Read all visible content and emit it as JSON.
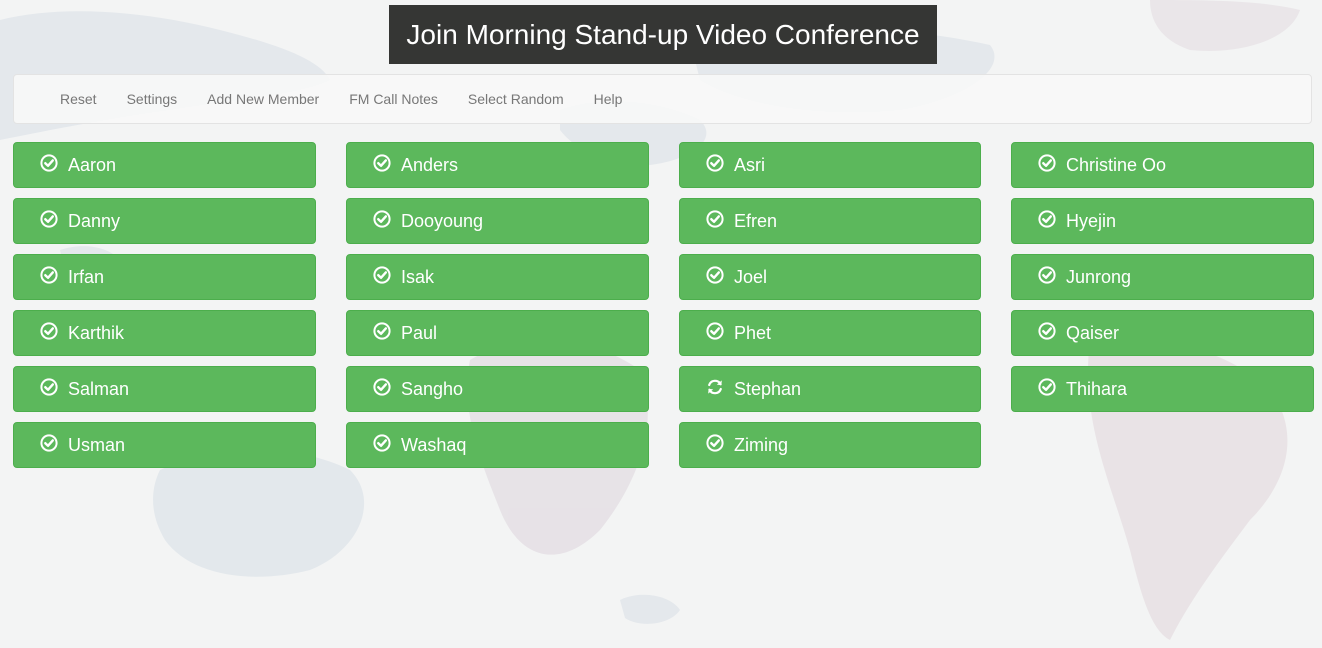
{
  "header": {
    "title": "Join Morning Stand-up Video Conference"
  },
  "nav": {
    "items": [
      {
        "label": "Reset"
      },
      {
        "label": "Settings"
      },
      {
        "label": "Add New Member"
      },
      {
        "label": "FM Call Notes"
      },
      {
        "label": "Select Random"
      },
      {
        "label": "Help"
      }
    ]
  },
  "colors": {
    "button": "#5cb85c",
    "title_bg": "#353634",
    "nav_text": "#777777"
  },
  "members": [
    {
      "name": "Aaron",
      "icon": "check-circle-icon"
    },
    {
      "name": "Anders",
      "icon": "check-circle-icon"
    },
    {
      "name": "Asri",
      "icon": "check-circle-icon"
    },
    {
      "name": "Christine Oo",
      "icon": "check-circle-icon"
    },
    {
      "name": "Danny",
      "icon": "check-circle-icon"
    },
    {
      "name": "Dooyoung",
      "icon": "check-circle-icon"
    },
    {
      "name": "Efren",
      "icon": "check-circle-icon"
    },
    {
      "name": "Hyejin",
      "icon": "check-circle-icon"
    },
    {
      "name": "Irfan",
      "icon": "check-circle-icon"
    },
    {
      "name": "Isak",
      "icon": "check-circle-icon"
    },
    {
      "name": "Joel",
      "icon": "check-circle-icon"
    },
    {
      "name": "Junrong",
      "icon": "check-circle-icon"
    },
    {
      "name": "Karthik",
      "icon": "check-circle-icon"
    },
    {
      "name": "Paul",
      "icon": "check-circle-icon"
    },
    {
      "name": "Phet",
      "icon": "check-circle-icon"
    },
    {
      "name": "Qaiser",
      "icon": "check-circle-icon"
    },
    {
      "name": "Salman",
      "icon": "check-circle-icon"
    },
    {
      "name": "Sangho",
      "icon": "check-circle-icon"
    },
    {
      "name": "Stephan",
      "icon": "refresh-icon"
    },
    {
      "name": "Thihara",
      "icon": "check-circle-icon"
    },
    {
      "name": "Usman",
      "icon": "check-circle-icon"
    },
    {
      "name": "Washaq",
      "icon": "check-circle-icon"
    },
    {
      "name": "Ziming",
      "icon": "check-circle-icon"
    }
  ]
}
